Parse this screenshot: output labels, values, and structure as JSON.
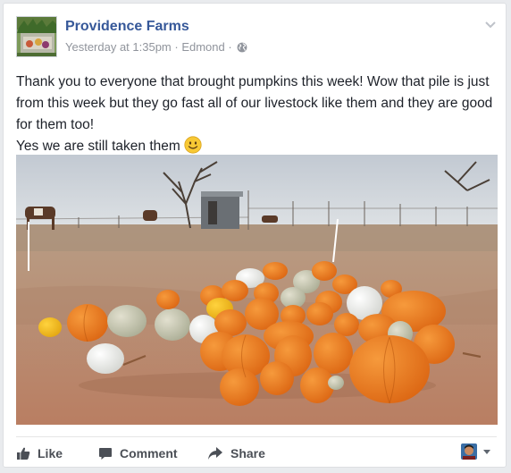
{
  "post": {
    "page_name": "Providence Farms",
    "timestamp": "Yesterday at 1:35pm",
    "separator": " · ",
    "location": "Edmond",
    "text_line1": "Thank you to everyone that brought pumpkins this week! Wow that pile is just from this week but they go fast all of our livestock like them and they are good for them too!",
    "text_line2": "Yes we are still taken them",
    "emoji": "slightly-smiling-face-icon",
    "privacy_icon": "globe-icon"
  },
  "actions": {
    "like_label": "Like",
    "comment_label": "Comment",
    "share_label": "Share"
  },
  "colors": {
    "link": "#365899",
    "meta": "#90949c",
    "text": "#1d2129",
    "action": "#4b4f56",
    "pumpkin": "#e8741c"
  }
}
